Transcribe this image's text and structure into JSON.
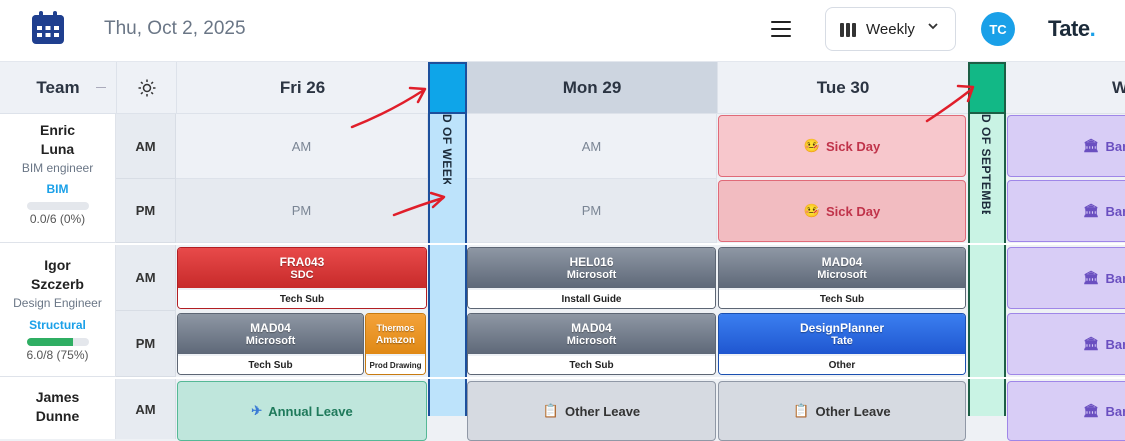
{
  "header": {
    "date": "Thu, Oct 2, 2025",
    "view_label": "Weekly",
    "avatar_initials": "TC",
    "logo_text": "Tate",
    "logo_dot": "."
  },
  "grid_header": {
    "team_label": "Team",
    "days": [
      "Fri 26",
      "Mon 29",
      "Tue 30",
      "W"
    ]
  },
  "dividers": {
    "week_end_label": "D OF WEEK",
    "month_end_label": "D OF SEPTEMBER"
  },
  "people": [
    {
      "name_line1": "Enric",
      "name_line2": "Luna",
      "role": "BIM engineer",
      "discipline": "BIM",
      "capacity_text": "0.0/6 (0%)",
      "capacity": 0.0
    },
    {
      "name_line1": "Igor",
      "name_line2": "Szczerb",
      "role": "Design Engineer",
      "discipline": "Structural",
      "capacity_text": "6.0/8 (75%)",
      "capacity": 0.75
    },
    {
      "name_line1": "James",
      "name_line2": "Dunne"
    }
  ],
  "slots": {
    "am": "AM",
    "pm": "PM"
  },
  "cells": {
    "r0_fri_am": "AM",
    "r0_fri_pm": "PM",
    "r0_mon_am": "AM",
    "r0_mon_pm": "PM",
    "sick_label": "Sick Day",
    "sick_icon": "🤒",
    "bank_label": "Ban",
    "bank_icon": "🏛"
  },
  "jobs": {
    "r1_fri_am": {
      "code": "FRA043",
      "client": "SDC",
      "task": "Tech Sub"
    },
    "r1_mon_am": {
      "code": "HEL016",
      "client": "Microsoft",
      "task": "Install Guide"
    },
    "r1_tue_am": {
      "code": "MAD04",
      "client": "Microsoft",
      "task": "Tech Sub"
    },
    "r1_fri_pm1": {
      "code": "MAD04",
      "client": "Microsoft",
      "task": "Tech Sub"
    },
    "r1_fri_pm2": {
      "code": "Thermos",
      "client": "Amazon",
      "task": "Prod Drawing"
    },
    "r1_mon_pm": {
      "code": "MAD04",
      "client": "Microsoft",
      "task": "Tech Sub"
    },
    "r1_tue_pm": {
      "code": "DesignPlanner",
      "client": "Tate",
      "task": "Other"
    }
  },
  "leaves": {
    "annual": "Annual Leave",
    "annual_icon": "✈",
    "other": "Other Leave",
    "other_icon": "📋"
  },
  "colors": {
    "accent": "#1aa0e8",
    "week_divider": "#1aa0e8",
    "month_divider": "#12b886",
    "annotation_arrow": "#e01e2a"
  }
}
